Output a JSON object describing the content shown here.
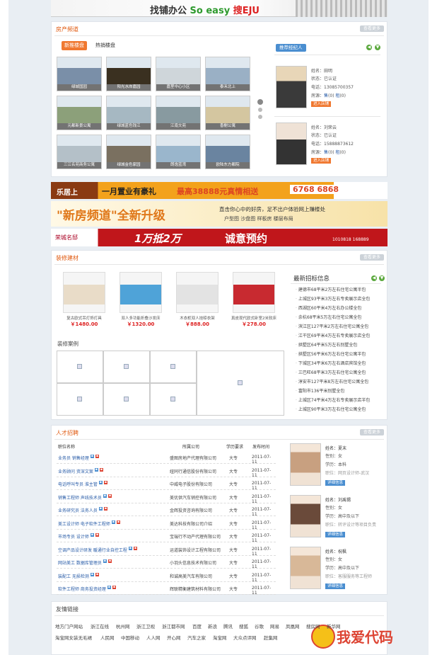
{
  "banner": {
    "slogan_pre": "找铺办公",
    "slogan_en": "So easy",
    "slogan_mid": "搜",
    "slogan_brand": "EJU"
  },
  "house": {
    "title": "房产频道",
    "more": "查看更多",
    "tabs": [
      "新推楼盘",
      "热销楼盘"
    ],
    "thumbs": [
      "绿城国园",
      "阳光水岸嘉园",
      "嘉里中心小区",
      "泰禾北上",
      "元都新景公寓",
      "绿城蓝色钱江",
      "江南文苑",
      "香榭公寓",
      "三江名苑商务公寓",
      "绿城金色家园",
      "朗逸蓝湾",
      "欧陆东方都院"
    ],
    "agent_tag": "推荐经纪人",
    "agents": [
      {
        "name": "姓名：田明",
        "status": "状态：已认证",
        "phone": "电话：13085700357",
        "rooms_label": "房源：",
        "sale": "售",
        "sale_n": "(0)",
        "rent": "租",
        "rent_n": "(0)",
        "btn": "进入店铺"
      },
      {
        "name": "姓名：刘荣云",
        "status": "状态：已认证",
        "phone": "电话：15888873612",
        "rooms_label": "房源：",
        "sale": "售",
        "sale_n": "(0)",
        "rent": "租",
        "rent_n": "(0)",
        "btn": "进入店铺"
      }
    ]
  },
  "ads": {
    "ad1_left": "乐居上",
    "ad1_text": "一月置业有豪礼",
    "ad1_hl": "最高38888元真情相送",
    "ad1_phone": "6768 6868",
    "ad2_big": "\"新房频道\"全新升级",
    "ad2_sub": "直击你心中的好房，足不出户体验网上赚楼处",
    "ad2_items": "户型图  沙盘图  样板房  楼层布局",
    "ad3_left": "荣城名邸",
    "ad3_big": "1万抵2万",
    "ad3_text": "诚意预约",
    "ad3_phone": "1010818 168889"
  },
  "deco": {
    "title": "装修建材",
    "more": "查看更多",
    "products": [
      {
        "name": "复古欧式吊灯饰灯具",
        "price": "￥1480.00"
      },
      {
        "name": "双人多功能折叠沙发床",
        "price": "￥1320.00"
      },
      {
        "name": "木衣柜双人挂晾衣架",
        "price": "￥888.00"
      },
      {
        "name": "真皮现代欧式卧室2米软床",
        "price": "￥278.00"
      }
    ],
    "cases_title": "装修案例",
    "bid_title": "最新招标信息",
    "bids": [
      "建德市68平米2万左右住宅公寓半包",
      "上城区93平米3万左右专卖展示店全包",
      "西湖区60平米4万左右办公楼全包",
      "余杭68平米5万左右住宅公寓全包",
      "滨江区127平米2万左右住宅公寓全包",
      "江干区69平米4万左右专卖展示店全包",
      "拱墅区64平米5万左右别墅全包",
      "拱墅区56平米6万左右住宅公寓半包",
      "下城区34平米6万左右酒店宾馆全包",
      "三巴旺68平米3万左右住宅公寓全包",
      "淳安市127平米8万左右住宅公寓全包",
      "富阳市136平米别墅全包",
      "上城区74平米4万左右专卖展示店半包",
      "上城区90平米3万左右住宅公寓全包"
    ]
  },
  "jobs": {
    "title": "人才招聘",
    "more": "查看更多",
    "head": [
      "职位名称",
      "所属公司",
      "学历要求",
      "发布时间"
    ],
    "rows": [
      {
        "t": "业务员 销售经理",
        "co": "盛图房地产代理有限公司",
        "ed": "大专",
        "dt": "2011-07-11"
      },
      {
        "t": "业务顾问 资深文案",
        "co": "纽同行通信股份有限公司",
        "ed": "大专",
        "dt": "2011-07-11"
      },
      {
        "t": "电话呼叫专员 淮主管",
        "co": "中威电子股份有限公司",
        "ed": "大专",
        "dt": "2011-07-11"
      },
      {
        "t": "销售工程师 声线技术员",
        "co": "美优供汽车销控有限公司",
        "ed": "大专",
        "dt": "2011-07-11"
      },
      {
        "t": "业务研究员 法务人员",
        "co": "金辉投资咨询有限公司",
        "ed": "大专",
        "dt": "2011-07-11"
      },
      {
        "t": "美工设计师 电子软件工程师",
        "co": "美达科技有限公司介绍",
        "ed": "大专",
        "dt": "2011-07-11"
      },
      {
        "t": "市场专员 设计师",
        "co": "宝瑞行不动产代理有限公司",
        "ed": "大专",
        "dt": "2011-07-11"
      },
      {
        "t": "空调产品设计研发 暖通行业自控工程",
        "co": "运道装饰设计工程有限公司",
        "ed": "大专",
        "dt": "2011-07-11"
      },
      {
        "t": "网站美工 数据库管理员",
        "co": "小羽头信息技术有限公司",
        "ed": "大专",
        "dt": "2011-07-11"
      },
      {
        "t": "装配工 无损检测",
        "co": "和诚高美汽车有限公司",
        "ed": "大专",
        "dt": "2011-07-11"
      },
      {
        "t": "软件工程师 商务投资经理",
        "co": "辉联精衡建筑材料有限公司",
        "ed": "大专",
        "dt": "2011-07-11"
      }
    ],
    "persons": [
      {
        "name": "姓名：夏末",
        "sex": "性别：女",
        "edu": "学历：本科",
        "job": "职位：网页设计师-武汉",
        "btn": "详细信息"
      },
      {
        "name": "姓名：刘禹锡",
        "sex": "性别：女",
        "edu": "学历：高中及以下",
        "job": "职位：转评设计等项目负责",
        "btn": "详细信息"
      },
      {
        "name": "姓名：祝枫",
        "sex": "性别：女",
        "edu": "学历：高中及以下",
        "job": "职位：客服服务等工程师",
        "btn": "详细信息"
      }
    ]
  },
  "links": {
    "title": "友情链接",
    "row1": [
      "地方门户网站",
      "浙江在线",
      "杭州网",
      "浙江卫视",
      "浙江都市网",
      "百度",
      "新浪",
      "腾讯",
      "搜狐",
      "谷歌",
      "网易",
      "凤凰网",
      "搜房网",
      "新华网"
    ],
    "row2": [
      "淘宝网女装无毛裙",
      "人民网",
      "中国移动",
      "人人网",
      "开心网",
      "汽车之家",
      "淘宝网",
      "大众点评网",
      "赶集网"
    ]
  },
  "watermark": "我爱代码"
}
